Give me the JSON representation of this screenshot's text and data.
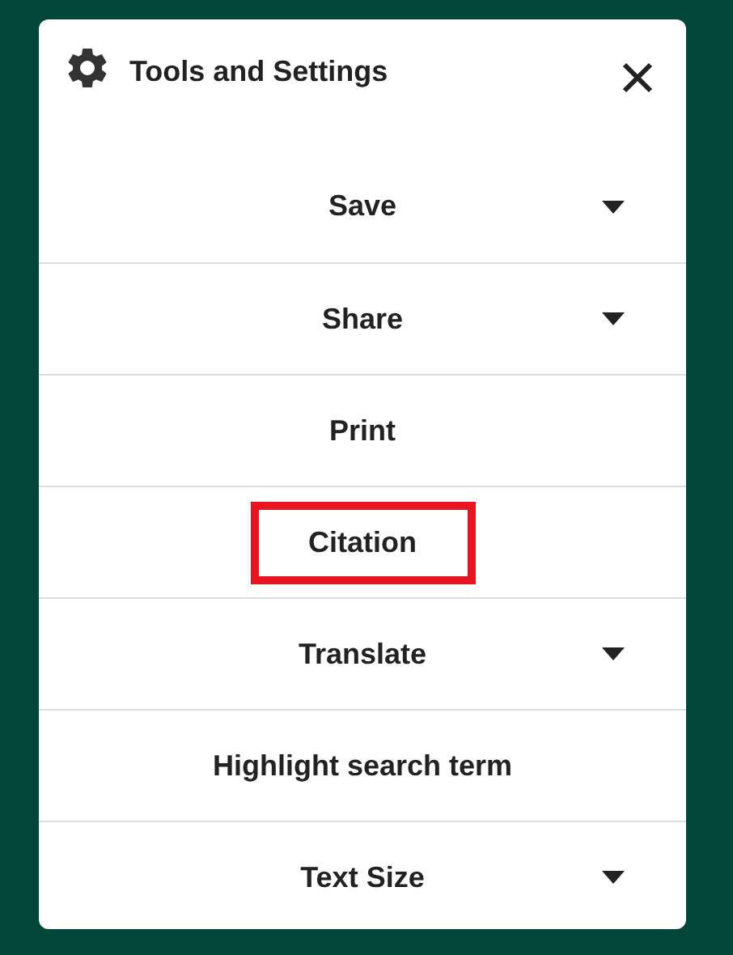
{
  "panel": {
    "title": "Tools and Settings"
  },
  "items": [
    {
      "label": "Save",
      "expandable": true,
      "highlighted": false
    },
    {
      "label": "Share",
      "expandable": true,
      "highlighted": false
    },
    {
      "label": "Print",
      "expandable": false,
      "highlighted": false
    },
    {
      "label": "Citation",
      "expandable": false,
      "highlighted": true
    },
    {
      "label": "Translate",
      "expandable": true,
      "highlighted": false
    },
    {
      "label": "Highlight search term",
      "expandable": false,
      "highlighted": false
    },
    {
      "label": "Text Size",
      "expandable": true,
      "highlighted": false
    }
  ]
}
